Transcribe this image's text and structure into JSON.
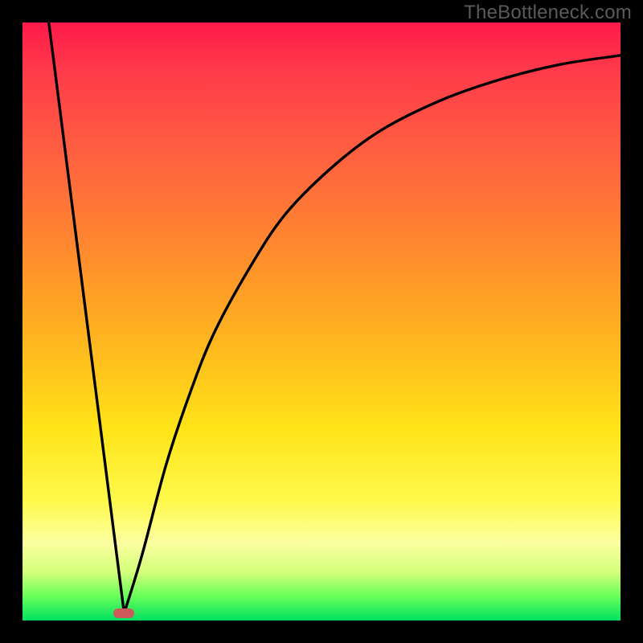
{
  "watermark": "TheBottleneck.com",
  "chart_data": {
    "type": "line",
    "title": "",
    "xlabel": "",
    "ylabel": "",
    "xlim": [
      0,
      1
    ],
    "ylim": [
      0,
      1
    ],
    "series": [
      {
        "name": "left-slope",
        "x": [
          0.044,
          0.17
        ],
        "y": [
          1.0,
          0.012
        ]
      },
      {
        "name": "right-curve",
        "x": [
          0.17,
          0.2,
          0.24,
          0.28,
          0.32,
          0.38,
          0.44,
          0.52,
          0.6,
          0.7,
          0.8,
          0.9,
          1.0
        ],
        "y": [
          0.012,
          0.11,
          0.26,
          0.38,
          0.48,
          0.59,
          0.68,
          0.76,
          0.82,
          0.87,
          0.905,
          0.93,
          0.945
        ]
      }
    ],
    "marker": {
      "x": 0.17,
      "y": 0.012
    },
    "colors": {
      "curve": "#000000",
      "marker": "#cc5a5a",
      "background_top": "#ff1a4a",
      "background_bottom": "#00e060",
      "frame": "#000000"
    }
  }
}
